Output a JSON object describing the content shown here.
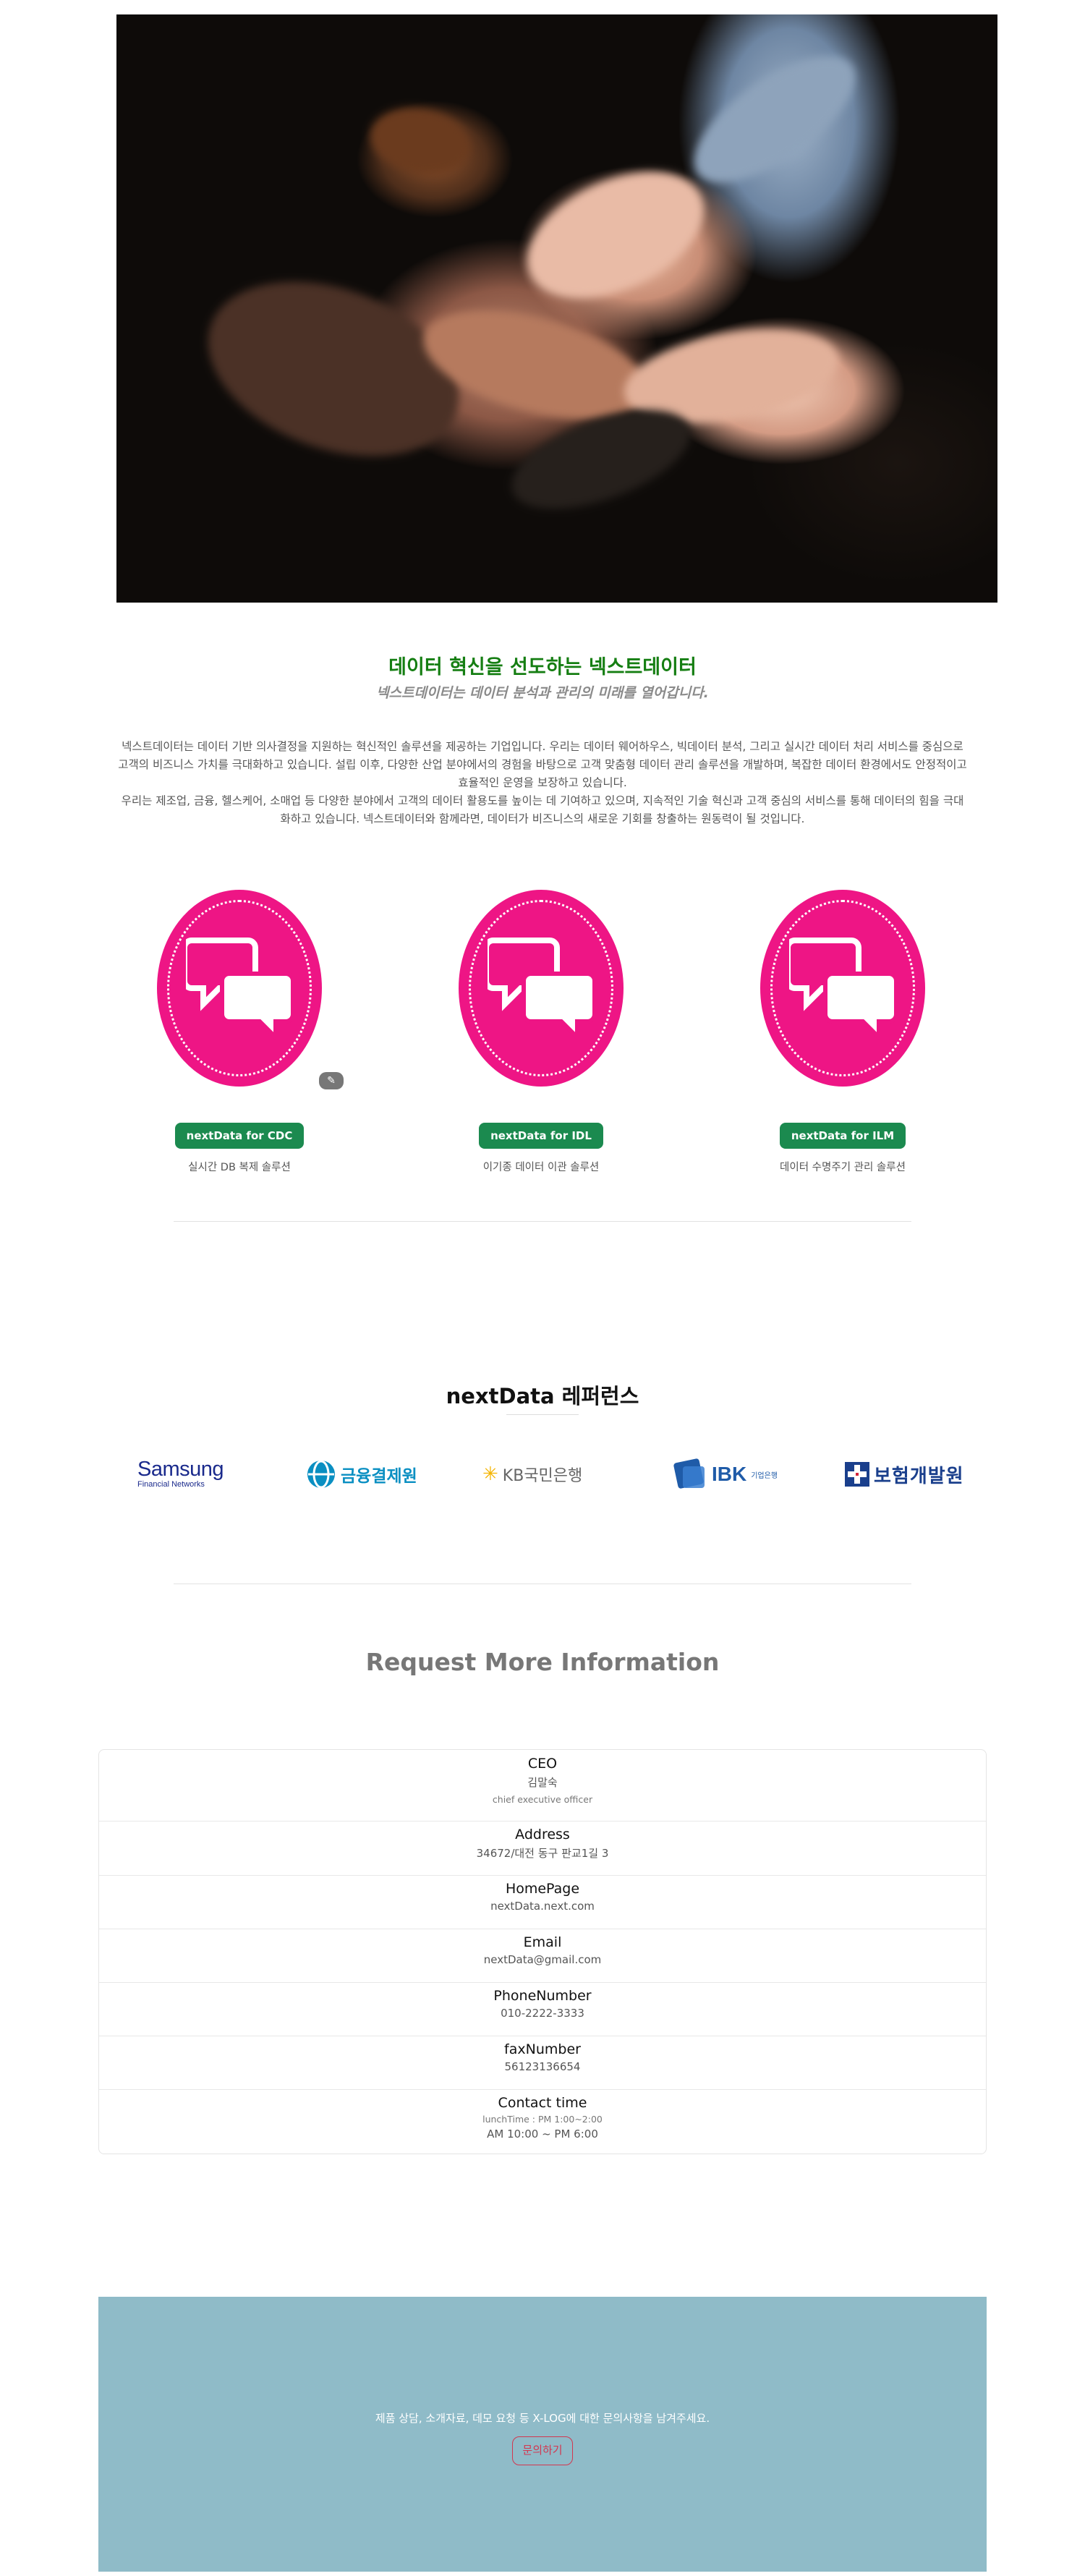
{
  "hero": {
    "icon": "teamwork-hands-photo"
  },
  "intro": {
    "title": "데이터 혁신을 선도하는 넥스트데이터",
    "subtitle": "넥스트데이터는 데이터 분석과 관리의 미래를 열어갑니다.",
    "paragraph1": "넥스트데이터는 데이터 기반 의사결정을 지원하는 혁신적인 솔루션을 제공하는 기업입니다. 우리는 데이터 웨어하우스, 빅데이터 분석, 그리고 실시간 데이터 처리 서비스를 중심으로 고객의 비즈니스 가치를 극대화하고 있습니다. 설립 이후, 다양한 산업 분야에서의 경험을 바탕으로 고객 맞춤형 데이터 관리 솔루션을 개발하며, 복잡한 데이터 환경에서도 안정적이고 효율적인 운영을 보장하고 있습니다.",
    "paragraph2": "우리는 제조업, 금융, 헬스케어, 소매업 등 다양한 분야에서 고객의 데이터 활용도를 높이는 데 기여하고 있으며, 지속적인 기술 혁신과 고객 중심의 서비스를 통해 데이터의 힘을 극대화하고 있습니다. 넥스트데이터와 함께라면, 데이터가 비즈니스의 새로운 기회를 창출하는 원동력이 될 것입니다."
  },
  "products": [
    {
      "label": "nextData for CDC",
      "desc": "실시간 DB 복제 솔루션",
      "icon": "chat-bubbles-icon"
    },
    {
      "label": "nextData for IDL",
      "desc": "이기종 데이터 이관 솔루션",
      "icon": "chat-bubbles-icon"
    },
    {
      "label": "nextData for ILM",
      "desc": "데이터 수명주기 관리 솔루션",
      "icon": "chat-bubbles-icon"
    }
  ],
  "edit_chip": {
    "icon": "edit-icon",
    "glyph": "✎"
  },
  "references": {
    "title": "nextData 레퍼런스",
    "logos": [
      {
        "name": "Samsung",
        "sub": "Financial Networks"
      },
      {
        "name": "금융결제원"
      },
      {
        "name": "KB국민은행",
        "mark": "KB"
      },
      {
        "name": "IBK",
        "sub": "기업은행"
      },
      {
        "name": "보험개발원"
      }
    ]
  },
  "request": {
    "title": "Request More Information",
    "rows": [
      {
        "label": "CEO",
        "value": "김말숙",
        "sub": "chief executive officer"
      },
      {
        "label": "Address",
        "value": "34672/대전 동구 판교1길 3"
      },
      {
        "label": "HomePage",
        "value": "nextData.next.com"
      },
      {
        "label": "Email",
        "value": "nextData@gmail.com"
      },
      {
        "label": "PhoneNumber",
        "value": "010-2222-3333"
      },
      {
        "label": "faxNumber",
        "value": "56123136654"
      },
      {
        "label": "Contact time",
        "sub": "lunchTime : PM 1:00~2:00",
        "value": "AM 10:00 ~ PM 6:00"
      }
    ]
  },
  "cta": {
    "text": "제품 상담, 소개자료, 데모 요청 등 X-LOG에 대한 문의사항을 남겨주세요.",
    "button": "문의하기"
  },
  "colors": {
    "title_green": "#157e12",
    "badge_pink": "#ee1585",
    "pill_green": "#1b8a4f",
    "cta_blue": "#8fbbc8",
    "cta_button_red": "#d3364f"
  }
}
